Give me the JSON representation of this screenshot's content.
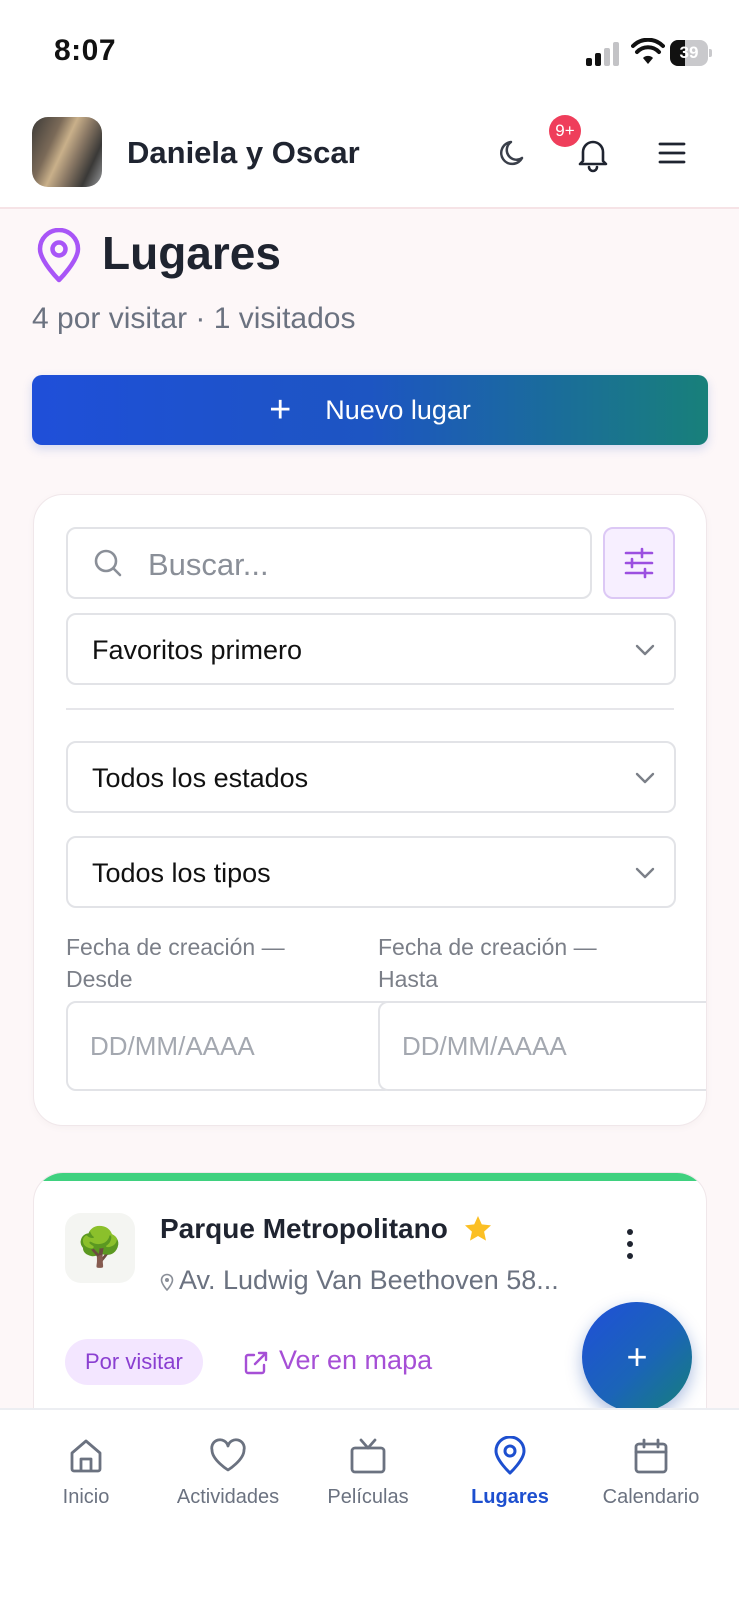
{
  "status_bar": {
    "time": "8:07",
    "battery": "39",
    "battery_level": 0.39,
    "signal_bars": 2
  },
  "header": {
    "couple_name": "Daniela y Oscar",
    "notification_badge": "9+"
  },
  "page": {
    "title": "Lugares",
    "subtitle": "4 por visitar · 1 visitados",
    "new_button_label": "Nuevo lugar"
  },
  "filters": {
    "search_placeholder": "Buscar...",
    "sort_selected": "Favoritos primero",
    "status_selected": "Todos los estados",
    "type_selected": "Todos los tipos",
    "date_from_label": "Fecha de creación — Desde",
    "date_to_label": "Fecha de creación — Hasta",
    "date_from_placeholder": "DD/MM/AAAA",
    "date_to_placeholder": "DD/MM/AAAA"
  },
  "places": [
    {
      "emoji": "🌳",
      "name": "Parque Metropolitano",
      "favorite": true,
      "address": "Av. Ludwig Van Beethoven 58...",
      "status": "Por visitar",
      "map_link": "Ver en mapa"
    }
  ],
  "fab": {
    "symbol": "+"
  },
  "nav": {
    "items": [
      {
        "label": "Inicio",
        "icon": "home-icon"
      },
      {
        "label": "Actividades",
        "icon": "heart-icon"
      },
      {
        "label": "Películas",
        "icon": "tv-icon"
      },
      {
        "label": "Lugares",
        "icon": "map-pin-icon",
        "active": true
      },
      {
        "label": "Calendario",
        "icon": "calendar-icon"
      }
    ]
  },
  "colors": {
    "accent_blue": "#1d4fcf",
    "accent_purple": "#a64fd6",
    "gradient_end_teal": "#18807a",
    "badge_red": "#ef3e5b",
    "status_green": "#3fd17f"
  }
}
